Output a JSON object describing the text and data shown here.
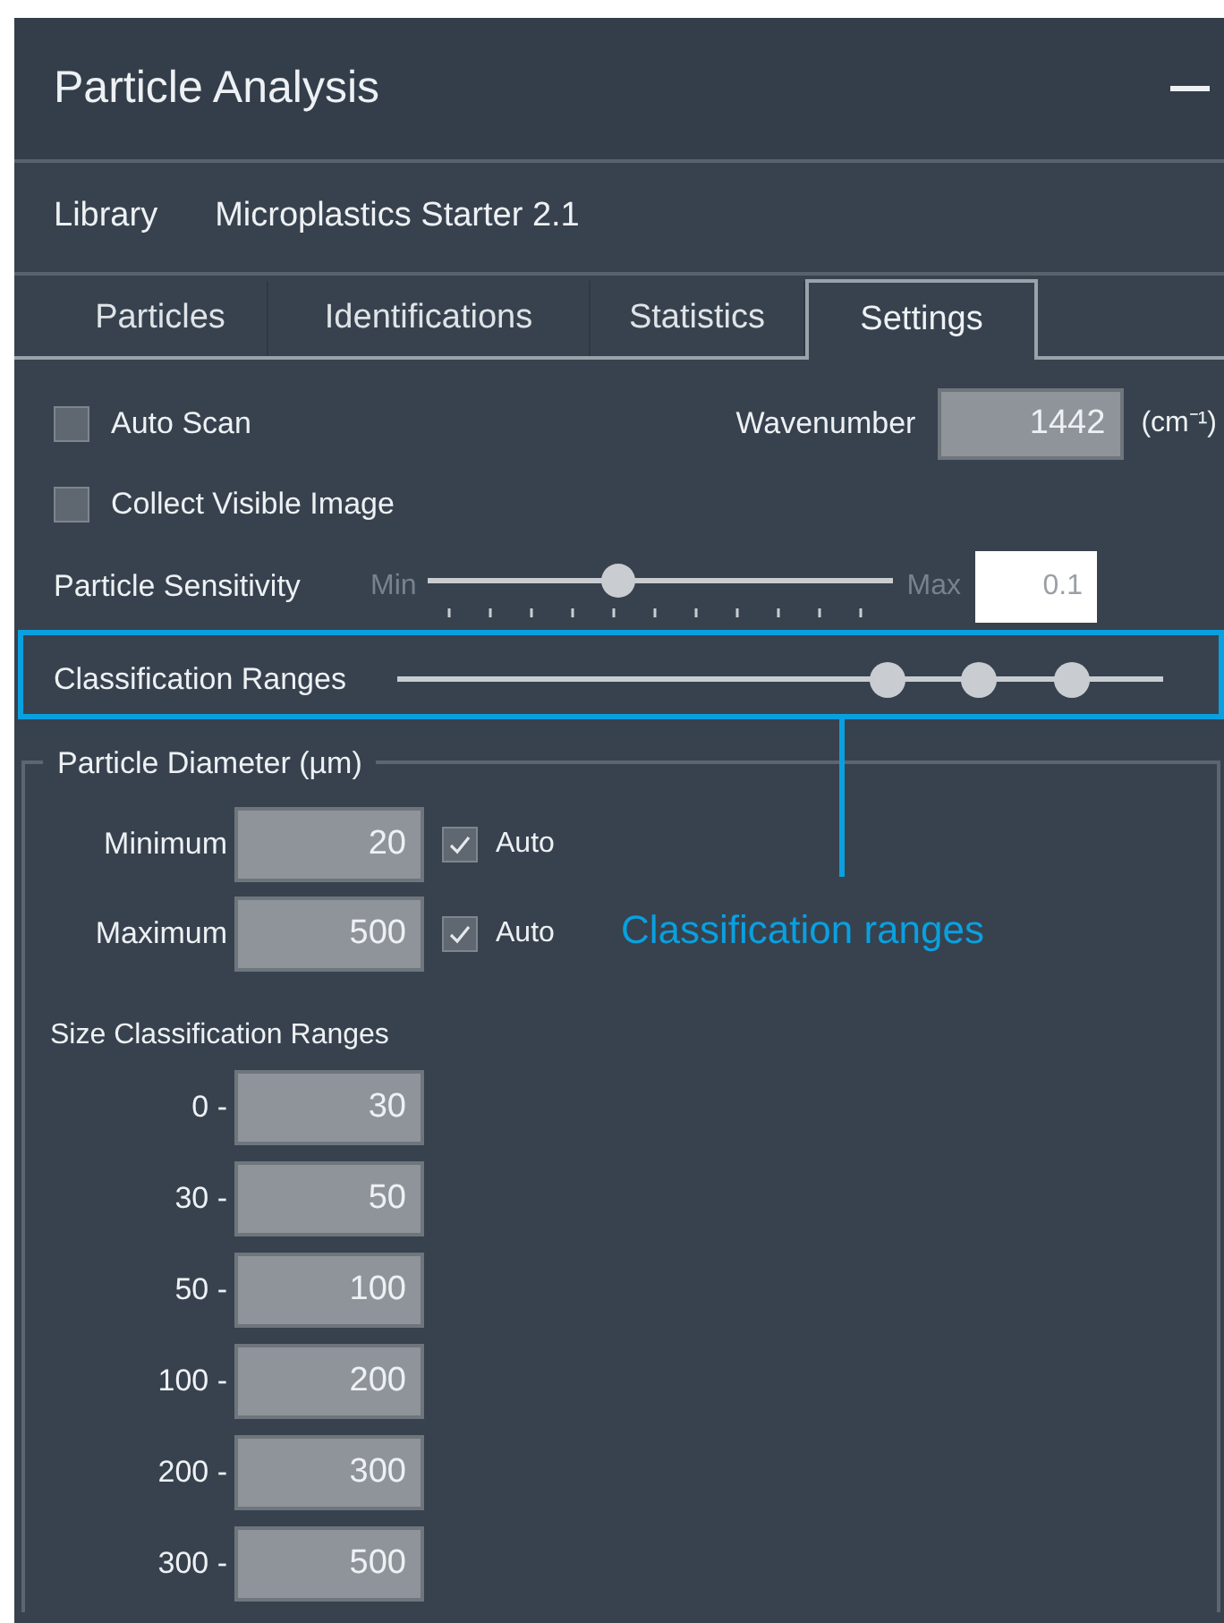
{
  "panel": {
    "title": "Particle Analysis"
  },
  "library": {
    "label": "Library",
    "value": "Microplastics Starter 2.1"
  },
  "tabs": [
    {
      "label": "Particles",
      "selected": false
    },
    {
      "label": "Identifications",
      "selected": false
    },
    {
      "label": "Statistics",
      "selected": false
    },
    {
      "label": "Settings",
      "selected": true
    }
  ],
  "auto_scan": {
    "label": "Auto Scan",
    "checked": false
  },
  "wavenumber": {
    "label": "Wavenumber",
    "value": "1442",
    "unit": "(cm⁻¹)"
  },
  "collect_visible_image": {
    "label": "Collect Visible Image",
    "checked": false
  },
  "particle_sensitivity": {
    "label": "Particle Sensitivity",
    "min_label": "Min",
    "max_label": "Max",
    "level": 0.41,
    "value": "0.1"
  },
  "classification_ranges": {
    "label": "Classification Ranges",
    "thumbs": [
      {
        "level": 0.64
      },
      {
        "level": 0.76
      },
      {
        "level": 0.88
      }
    ]
  },
  "particle_diameter": {
    "title": "Particle Diameter (µm)",
    "fields": [
      {
        "label": "Minimum",
        "value": "20",
        "auto_label": "Auto",
        "auto_checked": true
      },
      {
        "label": "Maximum",
        "value": "500",
        "auto_label": "Auto",
        "auto_checked": true
      }
    ]
  },
  "size_classification_ranges": {
    "title": "Size Classification Ranges",
    "rows": [
      {
        "label": "0 -",
        "value": "30"
      },
      {
        "label": "30 -",
        "value": "50"
      },
      {
        "label": "50 -",
        "value": "100"
      },
      {
        "label": "100 -",
        "value": "200"
      },
      {
        "label": "200 -",
        "value": "300"
      },
      {
        "label": "300 -",
        "value": "500"
      }
    ]
  },
  "annotation": {
    "label": "Classification ranges"
  }
}
